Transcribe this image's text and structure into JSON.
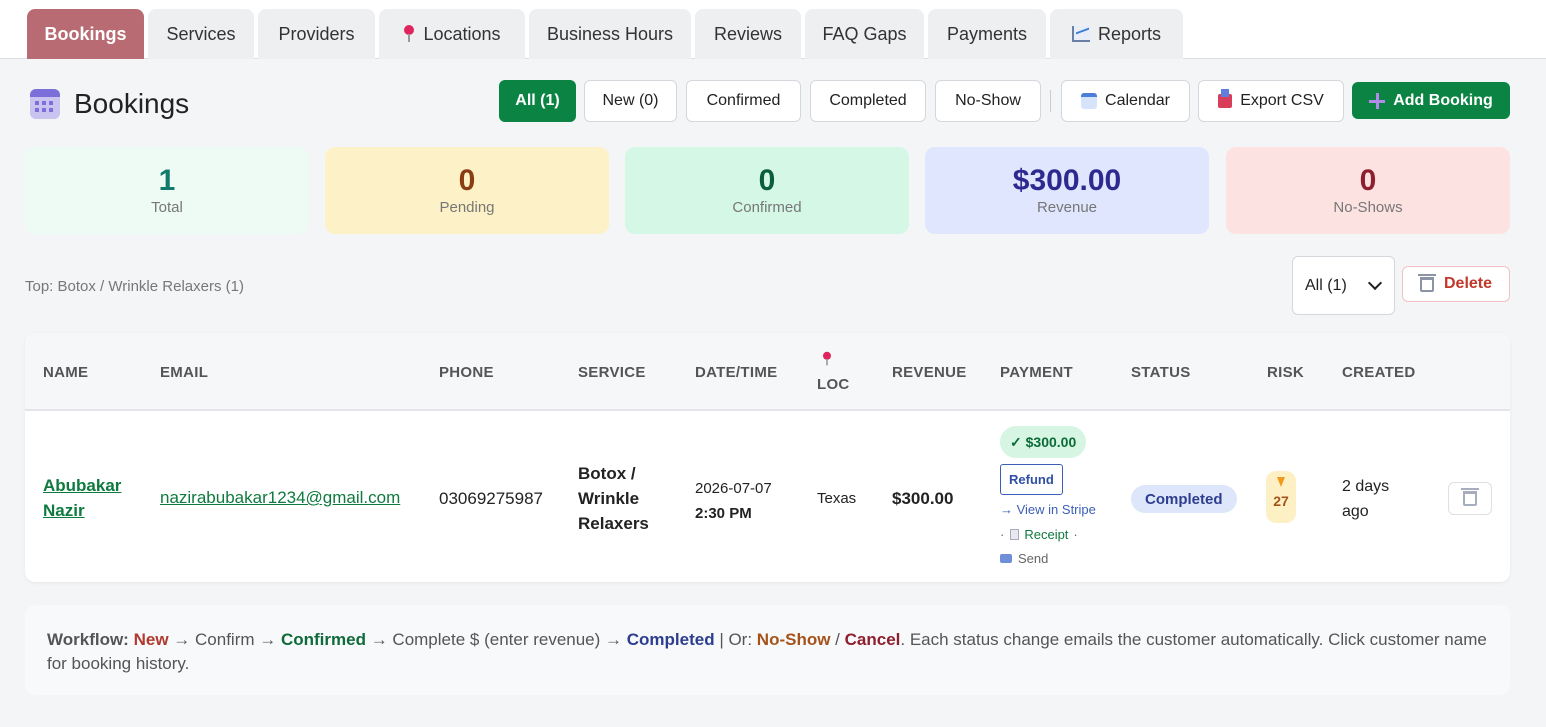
{
  "tabs": [
    {
      "label": "Bookings",
      "active": true
    },
    {
      "label": "Services"
    },
    {
      "label": "Providers"
    },
    {
      "label": "Locations",
      "icon": "pin-icon"
    },
    {
      "label": "Business Hours"
    },
    {
      "label": "Reviews"
    },
    {
      "label": "FAQ Gaps"
    },
    {
      "label": "Payments"
    },
    {
      "label": "Reports",
      "icon": "chart-icon"
    }
  ],
  "header": {
    "title": "Bookings",
    "icon": "calendar-icon",
    "filters": [
      "All (1)",
      "New (0)",
      "Confirmed",
      "Completed",
      "No-Show"
    ],
    "calendar_label": "Calendar",
    "export_label": "Export CSV",
    "add_label": "Add Booking"
  },
  "stats": [
    {
      "value": "1",
      "label": "Total",
      "color": "#127a6a",
      "bg": "#eefbf4"
    },
    {
      "value": "0",
      "label": "Pending",
      "color": "#8a3d12",
      "bg": "#fdf1c7"
    },
    {
      "value": "0",
      "label": "Confirmed",
      "color": "#0b5e3a",
      "bg": "#d4f7e6"
    },
    {
      "value": "$300.00",
      "label": "Revenue",
      "color": "#2d2a8f",
      "bg": "#dfe6fd"
    },
    {
      "value": "0",
      "label": "No-Shows",
      "color": "#8e1f2e",
      "bg": "#fde2e2"
    }
  ],
  "toolbar": {
    "top_service": "Top: Botox / Wrinkle Relaxers (1)",
    "select_value": "All (1)",
    "delete_label": "Delete"
  },
  "table": {
    "headers": [
      "NAME",
      "EMAIL",
      "PHONE",
      "SERVICE",
      "DATE/TIME",
      "LOC",
      "REVENUE",
      "PAYMENT",
      "STATUS",
      "RISK",
      "CREATED"
    ],
    "row": {
      "name_line1": "Abubakar",
      "name_line2": "Nazir",
      "email": "nazirabubakar1234@gmail.com",
      "phone": "03069275987",
      "service_line1": "Botox /",
      "service_line2": "Wrinkle",
      "service_line3": "Relaxers",
      "date": "2026-07-07",
      "time": "2:30 PM",
      "loc": "Texas",
      "revenue": "$300.00",
      "payment_paid": "✓ $300.00",
      "refund_label": "Refund",
      "view_stripe": "→ View in Stripe",
      "receipt": "Receipt",
      "send": "Send",
      "status": "Completed",
      "risk": "27",
      "created_line1": "2 days",
      "created_line2": "ago"
    }
  },
  "workflow": {
    "label": "Workflow:",
    "new": "New",
    "arrow1": " → Confirm → ",
    "confirmed": "Confirmed",
    "arrow2": " → Complete $ (enter revenue) → ",
    "completed": "Completed",
    "or": " | Or: ",
    "noshow": "No-Show",
    "slash": " / ",
    "cancel": "Cancel",
    "rest": ". Each status change emails the customer automatically. Click customer name for booking history."
  }
}
